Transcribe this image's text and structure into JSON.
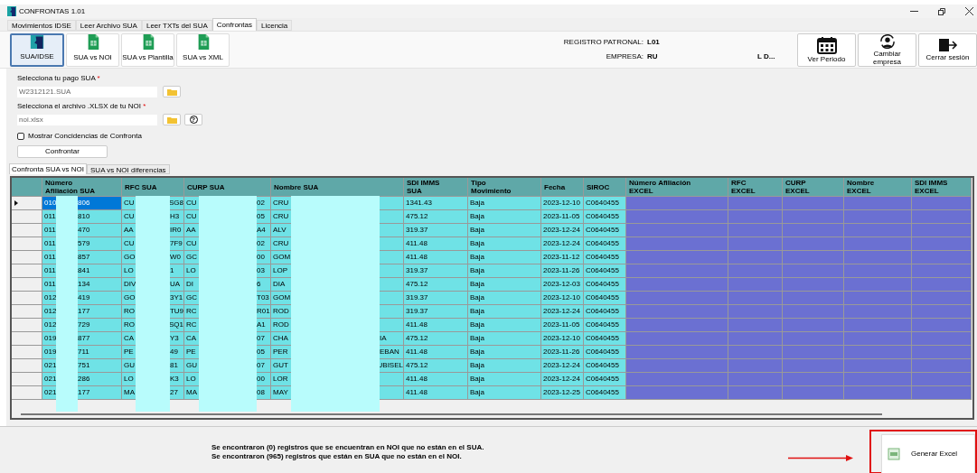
{
  "window": {
    "title": "CONFRONTAS 1.01"
  },
  "tabs": [
    {
      "label": "Movimientos IDSE",
      "selected": false
    },
    {
      "label": "Leer Archivo SUA",
      "selected": false
    },
    {
      "label": "Leer TXTs del SUA",
      "selected": false
    },
    {
      "label": "Confrontas",
      "selected": true
    },
    {
      "label": "Licencia",
      "selected": false
    }
  ],
  "modes": [
    {
      "label": "SUA/IDSE",
      "kind": "logo",
      "selected": true
    },
    {
      "label": "SUA vs NOI",
      "kind": "sheet",
      "selected": false
    },
    {
      "label": "SUA vs Plantilla",
      "kind": "sheet",
      "selected": false
    },
    {
      "label": "SUA vs XML",
      "kind": "sheet",
      "selected": false
    }
  ],
  "company": {
    "registro_label": "REGISTRO PATRONAL:",
    "registro_value": "L01",
    "empresa_label": "EMPRESA:",
    "empresa_start": "RU",
    "empresa_end": "L D..."
  },
  "actions": [
    {
      "label": "Ver Periodo",
      "kind": "calendar"
    },
    {
      "label": "Cambiar empresa",
      "kind": "switch-user"
    },
    {
      "label": "Cerrar sesión",
      "kind": "exit"
    }
  ],
  "fields": [
    {
      "label": "Selecciona tu pago SUA",
      "required": "*",
      "value": "W2312121.SUA"
    },
    {
      "label": "Selecciona el archivo .XLSX de tu NOI",
      "required": "*",
      "value": "noi.xlsx",
      "help": "?"
    }
  ],
  "checkbox": {
    "label": "Mostrar Concidencias de Confronta",
    "checked": false
  },
  "confront_button": "Confrontar",
  "subtabs": [
    {
      "label": "Confronta SUA vs NOI",
      "selected": true
    },
    {
      "label": "SUA vs NOI diferencias",
      "selected": false
    }
  ],
  "table": {
    "columns": [
      {
        "lines": [
          "Número",
          "Afiliación SUA"
        ],
        "kind": "sua"
      },
      {
        "lines": [
          "RFC SUA"
        ],
        "kind": "sua"
      },
      {
        "lines": [
          "CURP SUA"
        ],
        "kind": "sua"
      },
      {
        "lines": [
          "Nombre SUA"
        ],
        "kind": "sua"
      },
      {
        "lines": [
          "SDI IMMS",
          "SUA"
        ],
        "kind": "sua"
      },
      {
        "lines": [
          "Tipo",
          "Movimiento"
        ],
        "kind": "sua"
      },
      {
        "lines": [
          "Fecha"
        ],
        "kind": "sua"
      },
      {
        "lines": [
          "SIROC"
        ],
        "kind": "sua"
      },
      {
        "lines": [
          "Número Afiliación",
          "EXCEL"
        ],
        "kind": "excel"
      },
      {
        "lines": [
          "RFC",
          "EXCEL"
        ],
        "kind": "excel"
      },
      {
        "lines": [
          "CURP",
          "EXCEL"
        ],
        "kind": "excel"
      },
      {
        "lines": [
          "Nombre",
          "EXCEL"
        ],
        "kind": "excel"
      },
      {
        "lines": [
          "SDI IMMS",
          "EXCEL"
        ],
        "kind": "excel"
      }
    ],
    "rows": [
      {
        "selected": true,
        "cells": [
          [
            "010",
            "806"
          ],
          [
            "CU",
            "SG8"
          ],
          [
            "CU",
            "02"
          ],
          [
            "CRU"
          ],
          [
            "1341.43"
          ],
          [
            "Baja"
          ],
          [
            "2023-12-10"
          ],
          [
            "C0640455"
          ]
        ]
      },
      {
        "selected": false,
        "cells": [
          [
            "011",
            "810"
          ],
          [
            "CU",
            "H3"
          ],
          [
            "CU",
            "05"
          ],
          [
            "CRU"
          ],
          [
            "475.12"
          ],
          [
            "Baja"
          ],
          [
            "2023-11-05"
          ],
          [
            "C0640455"
          ]
        ]
      },
      {
        "selected": false,
        "cells": [
          [
            "011",
            "470"
          ],
          [
            "AA",
            "IR0"
          ],
          [
            "AA",
            "A4"
          ],
          [
            "ALV"
          ],
          [
            "319.37"
          ],
          [
            "Baja"
          ],
          [
            "2023-12-24"
          ],
          [
            "C0640455"
          ]
        ]
      },
      {
        "selected": false,
        "cells": [
          [
            "011",
            "579"
          ],
          [
            "CU",
            "7F9"
          ],
          [
            "CU",
            "02"
          ],
          [
            "CRU"
          ],
          [
            "411.48"
          ],
          [
            "Baja"
          ],
          [
            "2023-12-24"
          ],
          [
            "C0640455"
          ]
        ]
      },
      {
        "selected": false,
        "cells": [
          [
            "011",
            "857"
          ],
          [
            "GO",
            "W0"
          ],
          [
            "GC",
            "00"
          ],
          [
            "GOM"
          ],
          [
            "411.48"
          ],
          [
            "Baja"
          ],
          [
            "2023-11-12"
          ],
          [
            "C0640455"
          ]
        ]
      },
      {
        "selected": false,
        "cells": [
          [
            "011",
            "841"
          ],
          [
            "LO",
            "1"
          ],
          [
            "LO",
            "03"
          ],
          [
            "LOP"
          ],
          [
            "319.37"
          ],
          [
            "Baja"
          ],
          [
            "2023-11-26"
          ],
          [
            "C0640455"
          ]
        ]
      },
      {
        "selected": false,
        "cells": [
          [
            "011",
            "134"
          ],
          [
            "DIV",
            "UA"
          ],
          [
            "DI",
            "6"
          ],
          [
            "DIA"
          ],
          [
            "475.12"
          ],
          [
            "Baja"
          ],
          [
            "2023-12-03"
          ],
          [
            "C0640455"
          ]
        ]
      },
      {
        "selected": false,
        "cells": [
          [
            "012",
            "419"
          ],
          [
            "GO",
            "3Y1"
          ],
          [
            "GC",
            "T03"
          ],
          [
            "GOM"
          ],
          [
            "319.37"
          ],
          [
            "Baja"
          ],
          [
            "2023-12-10"
          ],
          [
            "C0640455"
          ]
        ]
      },
      {
        "selected": false,
        "cells": [
          [
            "012",
            "177"
          ],
          [
            "RO",
            "TU9"
          ],
          [
            "RC",
            "R01"
          ],
          [
            "ROD"
          ],
          [
            "319.37"
          ],
          [
            "Baja"
          ],
          [
            "2023-12-24"
          ],
          [
            "C0640455"
          ]
        ]
      },
      {
        "selected": false,
        "cells": [
          [
            "012",
            "729"
          ],
          [
            "RO",
            "SQ1"
          ],
          [
            "RC",
            "A1"
          ],
          [
            "ROD"
          ],
          [
            "411.48"
          ],
          [
            "Baja"
          ],
          [
            "2023-11-05"
          ],
          [
            "C0640455"
          ]
        ]
      },
      {
        "selected": false,
        "cells": [
          [
            "019",
            "877"
          ],
          [
            "CA",
            "Y3"
          ],
          [
            "CA",
            "07"
          ],
          [
            "CHA",
            "IA"
          ],
          [
            "475.12"
          ],
          [
            "Baja"
          ],
          [
            "2023-12-10"
          ],
          [
            "C0640455"
          ]
        ]
      },
      {
        "selected": false,
        "cells": [
          [
            "019",
            "711"
          ],
          [
            "PE",
            "49"
          ],
          [
            "PE",
            "05"
          ],
          [
            "PER",
            "EBAN"
          ],
          [
            "411.48"
          ],
          [
            "Baja"
          ],
          [
            "2023-11-26"
          ],
          [
            "C0640455"
          ]
        ]
      },
      {
        "selected": false,
        "cells": [
          [
            "021",
            "751"
          ],
          [
            "GU",
            "81"
          ],
          [
            "GU",
            "07"
          ],
          [
            "GUT",
            "UBISEL"
          ],
          [
            "475.12"
          ],
          [
            "Baja"
          ],
          [
            "2023-12-24"
          ],
          [
            "C0640455"
          ]
        ]
      },
      {
        "selected": false,
        "cells": [
          [
            "021",
            "286"
          ],
          [
            "LO",
            "K3"
          ],
          [
            "LO",
            "00"
          ],
          [
            "LOR"
          ],
          [
            "411.48"
          ],
          [
            "Baja"
          ],
          [
            "2023-12-24"
          ],
          [
            "C0640455"
          ]
        ]
      },
      {
        "selected": false,
        "cells": [
          [
            "021",
            "177"
          ],
          [
            "MA",
            "27"
          ],
          [
            "MA",
            "08"
          ],
          [
            "MAY"
          ],
          [
            "411.48"
          ],
          [
            "Baja"
          ],
          [
            "2023-12-25"
          ],
          [
            "C0640455"
          ]
        ]
      }
    ]
  },
  "messages": [
    "Se encontraron (0) registros que se encuentran en NOI que no están en el SUA.",
    "Se encontraron (965) registros que están en SUA que no están en el NOI."
  ],
  "export_button": "Generar Excel"
}
